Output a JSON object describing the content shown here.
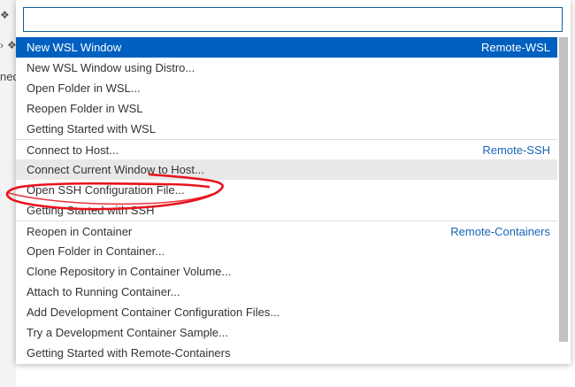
{
  "background": {
    "partial_text": "ned",
    "glyphs": [
      "❖",
      "›",
      "❖"
    ]
  },
  "quick_pick": {
    "filter_value": "",
    "filter_placeholder": "",
    "items": [
      {
        "label": "New WSL Window",
        "group": "Remote-WSL",
        "selected": true
      },
      {
        "label": "New WSL Window using Distro..."
      },
      {
        "label": "Open Folder in WSL..."
      },
      {
        "label": "Reopen Folder in WSL"
      },
      {
        "label": "Getting Started with WSL"
      },
      {
        "label": "Connect to Host...",
        "group": "Remote-SSH",
        "separator": true
      },
      {
        "label": "Connect Current Window to Host...",
        "hover": true
      },
      {
        "label": "Open SSH Configuration File..."
      },
      {
        "label": "Getting Started with SSH"
      },
      {
        "label": "Reopen in Container",
        "group": "Remote-Containers",
        "separator": true
      },
      {
        "label": "Open Folder in Container..."
      },
      {
        "label": "Clone Repository in Container Volume..."
      },
      {
        "label": "Attach to Running Container..."
      },
      {
        "label": "Add Development Container Configuration Files..."
      },
      {
        "label": "Try a Development Container Sample..."
      },
      {
        "label": "Getting Started with Remote-Containers"
      }
    ]
  },
  "colors": {
    "selection": "#0060c0",
    "group_label": "#1a63b8",
    "annotation": "#e8121b"
  }
}
